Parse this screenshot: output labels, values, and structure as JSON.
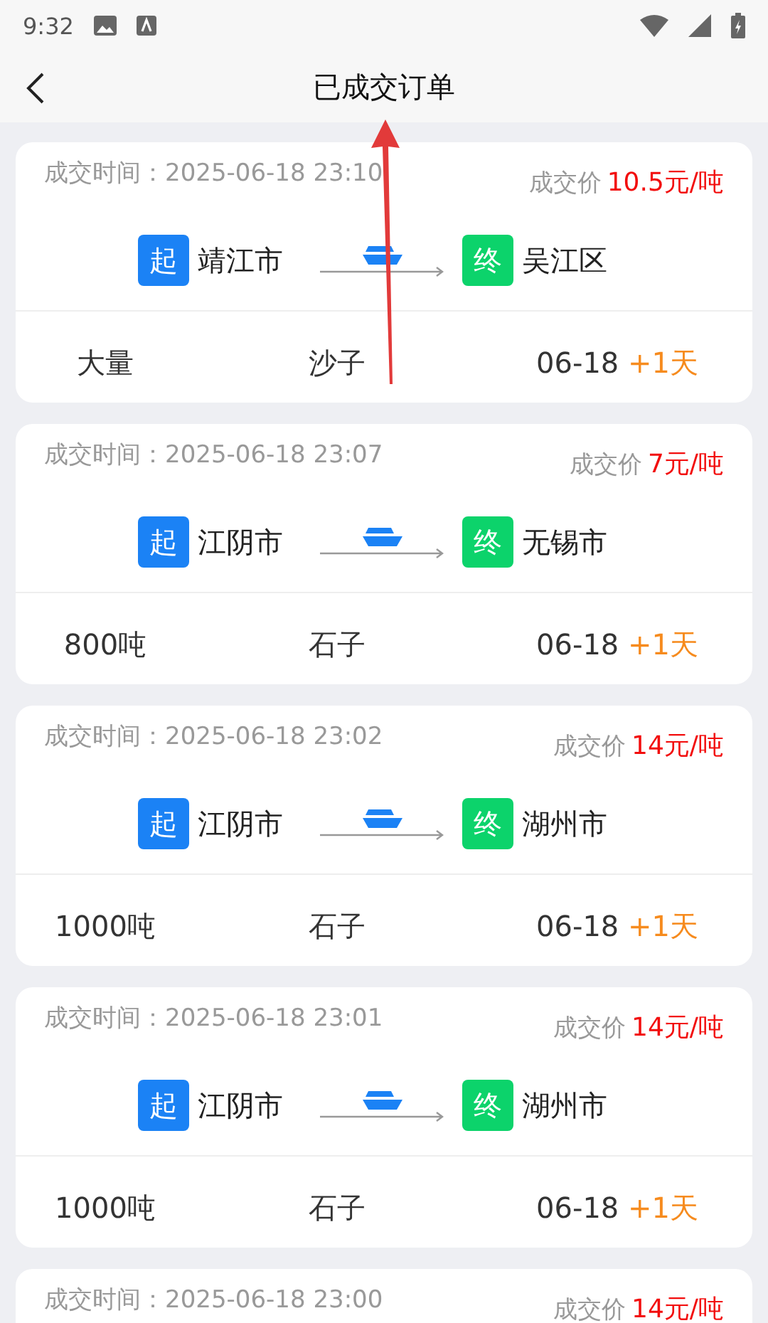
{
  "status_bar": {
    "time": "9:32"
  },
  "header": {
    "title": "已成交订单"
  },
  "orders": [
    {
      "time_label": "成交时间：",
      "time": "2025-06-18 23:10",
      "price_label": "成交价",
      "price": "10.5元/吨",
      "start_tag": "起",
      "start": "靖江市",
      "end_tag": "终",
      "end": "吴江区",
      "quantity": "大量",
      "cargo": "沙子",
      "date": "06-18",
      "extra": "+1天"
    },
    {
      "time_label": "成交时间：",
      "time": "2025-06-18 23:07",
      "price_label": "成交价",
      "price": "7元/吨",
      "start_tag": "起",
      "start": "江阴市",
      "end_tag": "终",
      "end": "无锡市",
      "quantity": "800吨",
      "cargo": "石子",
      "date": "06-18",
      "extra": "+1天"
    },
    {
      "time_label": "成交时间：",
      "time": "2025-06-18 23:02",
      "price_label": "成交价",
      "price": "14元/吨",
      "start_tag": "起",
      "start": "江阴市",
      "end_tag": "终",
      "end": "湖州市",
      "quantity": "1000吨",
      "cargo": "石子",
      "date": "06-18",
      "extra": "+1天"
    },
    {
      "time_label": "成交时间：",
      "time": "2025-06-18 23:01",
      "price_label": "成交价",
      "price": "14元/吨",
      "start_tag": "起",
      "start": "江阴市",
      "end_tag": "终",
      "end": "湖州市",
      "quantity": "1000吨",
      "cargo": "石子",
      "date": "06-18",
      "extra": "+1天"
    },
    {
      "time_label": "成交时间：",
      "time": "2025-06-18 23:00",
      "price_label": "成交价",
      "price": "14元/吨"
    }
  ]
}
